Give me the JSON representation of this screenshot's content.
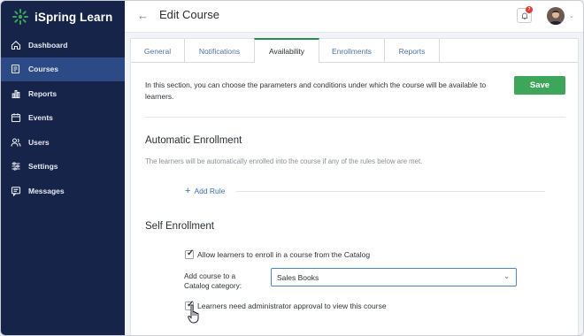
{
  "app": {
    "name": "iSpring Learn",
    "brand_color": "#3da65a",
    "sidebar_bg": "#16244a",
    "active_bg": "#2b4a86"
  },
  "sidebar": {
    "items": [
      {
        "label": "Dashboard",
        "icon": "home-icon",
        "active": false
      },
      {
        "label": "Courses",
        "icon": "courses-icon",
        "active": true
      },
      {
        "label": "Reports",
        "icon": "bar-chart-icon",
        "active": false
      },
      {
        "label": "Events",
        "icon": "calendar-icon",
        "active": false
      },
      {
        "label": "Users",
        "icon": "users-icon",
        "active": false
      },
      {
        "label": "Settings",
        "icon": "sliders-icon",
        "active": false
      },
      {
        "label": "Messages",
        "icon": "message-icon",
        "active": false
      }
    ]
  },
  "header": {
    "back_icon": "←",
    "title": "Edit Course",
    "notification_count": "7",
    "avatar_chevron": "⌄"
  },
  "tabs": [
    {
      "label": "General",
      "active": false
    },
    {
      "label": "Notifications",
      "active": false
    },
    {
      "label": "Availability",
      "active": true
    },
    {
      "label": "Enrollments",
      "active": false
    },
    {
      "label": "Reports",
      "active": false
    }
  ],
  "main": {
    "intro": "In this section, you can choose the parameters and conditions under which the course will be available to learners.",
    "save_label": "Save",
    "auto_enrollment": {
      "heading": "Automatic Enrollment",
      "description": "The learners will be automatically enrolled into the course if any of the rules below are met.",
      "add_rule_plus": "+",
      "add_rule_label": "Add Rule"
    },
    "self_enrollment": {
      "heading": "Self Enrollment",
      "allow_catalog_label": "Allow learners to enroll in a course from the Catalog",
      "allow_catalog_checked": true,
      "category_label": "Add course to a Catalog category:",
      "category_value": "Sales Books",
      "approval_label": "Learners need administrator approval to view this course",
      "approval_checked": true
    },
    "checkmark": "✓",
    "select_chevron": "⌄"
  }
}
